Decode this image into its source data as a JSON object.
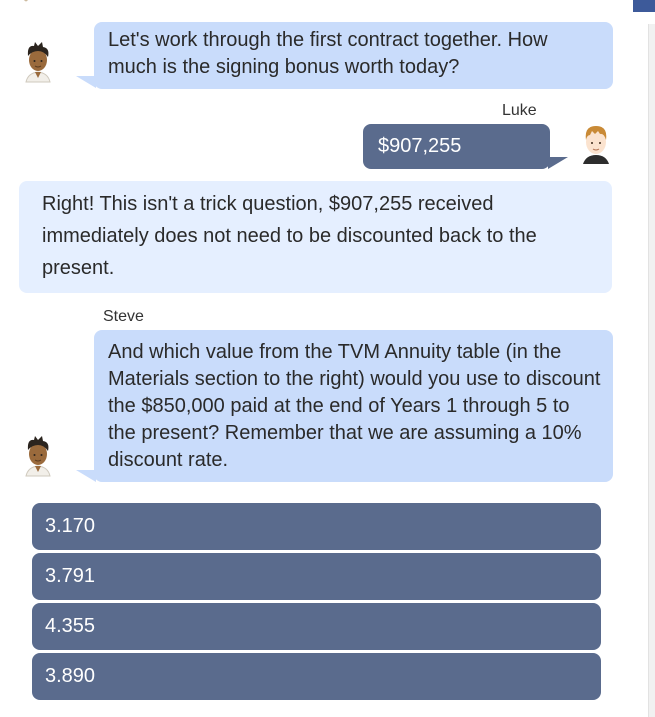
{
  "conversation": {
    "steve_message_1": "Let's work through the first contract together. How much is the signing bonus worth today?",
    "luke_name": "Luke",
    "luke_answer": "$907,255",
    "feedback": "Right! This isn't a trick question, $907,255 received immediately does not need to be discounted back to the present.",
    "steve_name": "Steve",
    "steve_message_2": "And which value from the TVM Annuity table (in the Materials section to the right) would you use to discount the $850,000 paid at the end of Years 1 through 5 to the present? Remember that we are assuming a 10% discount rate."
  },
  "options": [
    "3.170",
    "3.791",
    "4.355",
    "3.890"
  ],
  "colors": {
    "steve_bubble": "#c9dcfb",
    "luke_bubble": "#5a6b8d",
    "feedback_bubble": "#e5efff",
    "option_button": "#5a6b8d"
  }
}
